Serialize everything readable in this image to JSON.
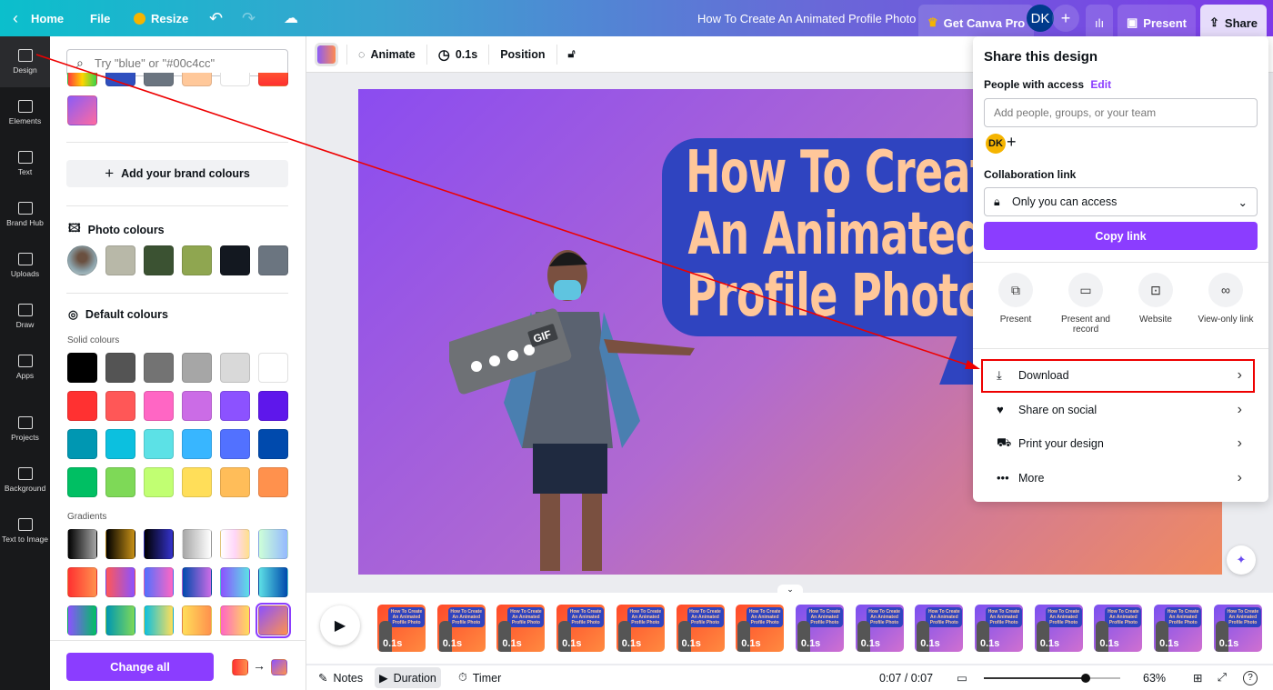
{
  "topbar": {
    "home": "Home",
    "file": "File",
    "resize": "Resize",
    "title": "How To Create An Animated Profile Photo",
    "get_pro": "Get Canva Pro",
    "avatar": "DK",
    "present": "Present",
    "share": "Share"
  },
  "rail": [
    {
      "label": "Design",
      "icon": "layout-icon"
    },
    {
      "label": "Elements",
      "icon": "shapes-icon"
    },
    {
      "label": "Text",
      "icon": "text-icon"
    },
    {
      "label": "Brand Hub",
      "icon": "brand-icon"
    },
    {
      "label": "Uploads",
      "icon": "upload-icon"
    },
    {
      "label": "Draw",
      "icon": "pen-icon"
    },
    {
      "label": "Apps",
      "icon": "apps-icon"
    },
    {
      "label": "Projects",
      "icon": "folder-icon"
    },
    {
      "label": "Background",
      "icon": "background-icon"
    },
    {
      "label": "Text to Image",
      "icon": "text-to-image-icon"
    }
  ],
  "panel": {
    "search_placeholder": "Try \"blue\" or \"#00c4cc\"",
    "add_brand": "Add your brand colours",
    "photo_colours": "Photo colours",
    "default_colours": "Default colours",
    "solid_colours": "Solid colours",
    "gradients": "Gradients",
    "change_all": "Change all",
    "top_row": [
      "linear-gradient(90deg,#ff3b3b,#ffd400,#3bd34a)",
      "#2f4fbf",
      "#6b7580",
      "#ffc89a",
      "#ffffff",
      "linear-gradient(180deg,#ff7a30,#ff3030)"
    ],
    "top_extra": "linear-gradient(135deg,#8b5cf6,#ff6aa0)",
    "photo": [
      "#b8b8a8",
      "#3b5232",
      "#8fa650",
      "#131820",
      "#6b7580"
    ],
    "solid": [
      "#000000",
      "#545454",
      "#737373",
      "#a6a6a6",
      "#d9d9d9",
      "#ffffff",
      "#ff3131",
      "#ff5757",
      "#ff66c4",
      "#cb6ce6",
      "#8c52ff",
      "#5e17eb",
      "#0097b2",
      "#0cc0df",
      "#5ce1e6",
      "#38b6ff",
      "#5271ff",
      "#004aad",
      "#00bf63",
      "#7ed957",
      "#c1ff72",
      "#ffde59",
      "#ffbd59",
      "#ff914d"
    ],
    "gradient_list": [
      "linear-gradient(90deg,#000,#a6a6a6)",
      "linear-gradient(90deg,#000,#c89116)",
      "linear-gradient(90deg,#000,#3533cd)",
      "linear-gradient(90deg,#a6a6a6,#fff)",
      "linear-gradient(90deg,#fff,#ffd6f8,#ffe08a)",
      "linear-gradient(90deg,#cdffd8,#94b9ff)",
      "linear-gradient(90deg,#ff3131,#ff914d)",
      "linear-gradient(90deg,#ff5757,#8c52ff)",
      "linear-gradient(90deg,#5170ff,#ff66c4)",
      "linear-gradient(90deg,#004aad,#cb6ce6)",
      "linear-gradient(90deg,#8c52ff,#5ce1e6)",
      "linear-gradient(90deg,#5de0e6,#004aad)",
      "linear-gradient(90deg,#8c52ff,#00bf63)",
      "linear-gradient(90deg,#0097b2,#7ed957)",
      "linear-gradient(90deg,#0cc0df,#ffde59)",
      "linear-gradient(90deg,#ffde59,#ff914d)",
      "linear-gradient(90deg,#ff66c4,#ffde59)",
      "linear-gradient(135deg,#8c52ff,#ff914d)"
    ]
  },
  "toolbar": {
    "animate": "Animate",
    "duration": "0.1s",
    "position": "Position"
  },
  "canvas": {
    "title_lines": [
      "How To Create",
      "An Animated",
      "Profile Photo"
    ],
    "gif_label": "GIF"
  },
  "share_panel": {
    "title": "Share this design",
    "people": "People with access",
    "edit": "Edit",
    "input_placeholder": "Add people, groups, or your team",
    "avatar": "DK",
    "collab": "Collaboration link",
    "access": "Only you can access",
    "copy": "Copy link",
    "options": [
      {
        "label": "Present",
        "icon": "present-icon"
      },
      {
        "label": "Present and record",
        "icon": "camera-icon"
      },
      {
        "label": "Website",
        "icon": "website-icon"
      },
      {
        "label": "View-only link",
        "icon": "link-icon"
      }
    ],
    "rows": [
      {
        "label": "Download",
        "icon": "download-icon"
      },
      {
        "label": "Share on social",
        "icon": "heart-icon"
      },
      {
        "label": "Print your design",
        "icon": "truck-icon"
      },
      {
        "label": "More",
        "icon": "more-icon"
      }
    ]
  },
  "timeline": {
    "thumb_duration": "0.1s",
    "thumb_text": "How To Create An Animated Profile Photo",
    "pages_orange": 7,
    "pages_purple": 8
  },
  "bottom": {
    "notes": "Notes",
    "duration": "Duration",
    "timer": "Timer",
    "time": "0:07 / 0:07",
    "zoom": "63%",
    "zoom_level": 63
  },
  "colors": {
    "accent": "#8b3dff",
    "highlight": "#ff0000"
  }
}
